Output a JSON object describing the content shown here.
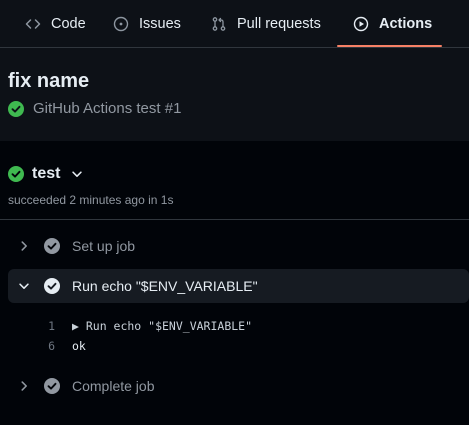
{
  "tabs": [
    {
      "label": "Code",
      "icon": "code-icon"
    },
    {
      "label": "Issues",
      "icon": "issue-opened-icon"
    },
    {
      "label": "Pull requests",
      "icon": "git-pull-request-icon"
    },
    {
      "label": "Actions",
      "icon": "play-icon",
      "active": true
    }
  ],
  "run": {
    "title": "fix name",
    "subtitle": "GitHub Actions test #1",
    "status": "success"
  },
  "job": {
    "name": "test",
    "meta": "succeeded 2 minutes ago in 1s",
    "steps": [
      {
        "label": "Set up job",
        "expanded": false
      },
      {
        "label": "Run echo \"$ENV_VARIABLE\"",
        "expanded": true
      },
      {
        "label": "Complete job",
        "expanded": false
      }
    ],
    "log": [
      {
        "line": "1",
        "text": "▶ Run echo \"$ENV_VARIABLE\""
      },
      {
        "line": "6",
        "text": "ok"
      }
    ]
  },
  "colors": {
    "accent_underline": "#f78166",
    "success": "#3fb950",
    "background": "#010409",
    "panel": "#0d1117"
  }
}
